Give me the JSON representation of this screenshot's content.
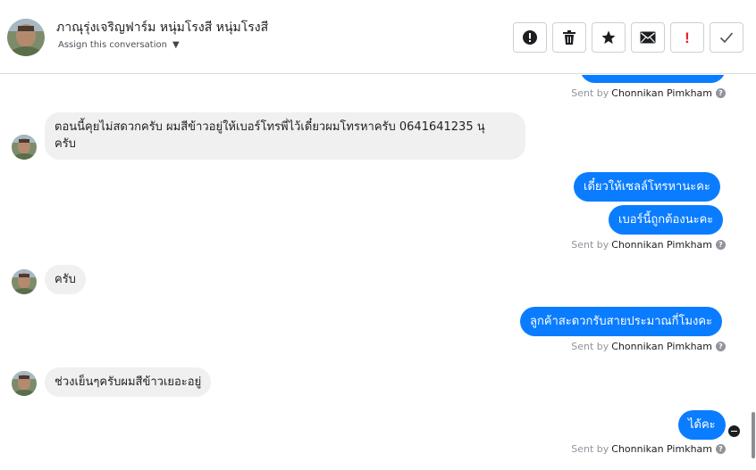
{
  "header": {
    "contact_name": "ภาณุรุ่งเจริญฟาร์ม หนุ่มโรงสี หนุ่มโรงสี",
    "assign_label": "Assign this conversation",
    "actions": [
      "spam-report",
      "delete",
      "star",
      "email",
      "mark-important",
      "mark-done"
    ]
  },
  "sent_prefix": "Sent by",
  "agent_name": "Chonnikan Pimkham",
  "messages": [
    {
      "dir": "in",
      "text": "ตอนนี้คุยไม่สดวกครับ ผมสีข้าวอยู่ให้เบอร์โทรพี่ไว้เดี๋ยวผมโทรหาครับ  0641641235  นุ"
    },
    {
      "dir": "in-cont",
      "text": "ครับ"
    },
    {
      "dir": "out",
      "text": "เดี๋ยวให้เซลล์โทรหานะคะ"
    },
    {
      "dir": "out",
      "text": "เบอร์นี้ถูกต้องนะคะ"
    },
    {
      "dir": "in",
      "text": "ครับ"
    },
    {
      "dir": "out",
      "text": "ลูกค้าสะดวกรับสายประมาณกี่โมงคะ"
    },
    {
      "dir": "in",
      "text": "ช่วงเย็นๆครับผมสีข้าวเยอะอยู่"
    },
    {
      "dir": "out",
      "text": "ได้คะ"
    }
  ],
  "help_icon": "?",
  "colors": {
    "outgoing": "#0a7cff",
    "incoming": "#f0f0f0",
    "divider": "#dadde1"
  }
}
